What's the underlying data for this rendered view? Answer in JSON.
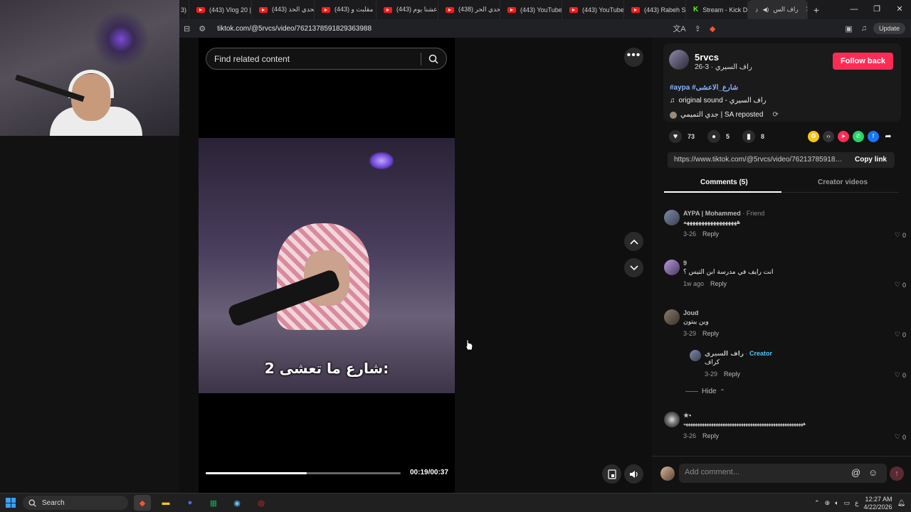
{
  "browser": {
    "tabs": [
      {
        "label": "3)"
      },
      {
        "label": "(443) Vlog 20 |"
      },
      {
        "label": "(443) تحدي الحذ"
      },
      {
        "label": "(443) مقلبت و"
      },
      {
        "label": "(443) عشنا يوم"
      },
      {
        "label": "(438) تحدي الحر"
      },
      {
        "label": "(443) YouTube"
      },
      {
        "label": "(443) YouTube"
      },
      {
        "label": "(443) Rabeh Sa"
      },
      {
        "label": "Stream - Kick D"
      },
      {
        "label": "راف الس"
      }
    ],
    "url": "tiktok.com/@5rvcs/video/7621378591829363988",
    "update_label": "Update"
  },
  "search": {
    "placeholder": "Find related content"
  },
  "video": {
    "caption": "شارع ما تعشى 2:",
    "time": "00:19/00:37",
    "progress": 0.52
  },
  "post": {
    "username": "5rvcs",
    "subline": "راف السيري · 3-26",
    "follow_label": "Follow back",
    "hashtags": "#aypa #شارع_الاعشى",
    "sound": "original sound - راف السيري",
    "repost": "جدي التميمي | SA reposted",
    "likes": "73",
    "comments_count": "5",
    "saves": "8",
    "link": "https://www.tiktok.com/@5rvcs/video/7621378591829...",
    "copy_label": "Copy link"
  },
  "tabs": {
    "comments": "Comments (5)",
    "creator_videos": "Creator videos"
  },
  "comments": [
    {
      "name": "AYPA | Mohammed",
      "tag": " · Friend",
      "text": "ههههههههههههههههههه",
      "date": "3-26",
      "reply": "Reply",
      "likes": "0"
    },
    {
      "name": "9",
      "tag": "",
      "text": "انت رايف في مدرسة ابن التيس ؟",
      "date": "1w ago",
      "reply": "Reply",
      "likes": "0"
    },
    {
      "name": "Joud",
      "tag": "",
      "text": "وين يبتون",
      "date": "3-29",
      "reply": "Reply",
      "likes": "0"
    },
    {
      "name": "راف السيري",
      "tag": "Creator",
      "text": "كراف",
      "date": "3-29",
      "reply": "Reply",
      "likes": "0"
    },
    {
      "name": "★•",
      "tag": "",
      "text": "ههههههههههههههههههههههههههههههههههههههههههههههههههههه",
      "date": "3-26",
      "reply": "Reply",
      "likes": "0"
    }
  ],
  "hide_label": "Hide",
  "comment_box": {
    "placeholder": "Add comment..."
  },
  "taskbar": {
    "search": "Search",
    "time": "12:27 AM",
    "date": "4/22/2026"
  }
}
